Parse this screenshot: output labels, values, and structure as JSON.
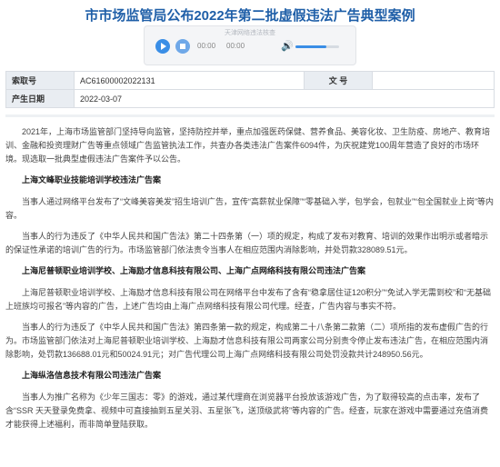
{
  "title": "市市场监管局公布2022年第二批虚假违法广告典型案例",
  "player": {
    "caption": "天津网络违法核查",
    "current_time": "00:00",
    "total_time": "00:00"
  },
  "meta": {
    "index_label": "索取号",
    "index_value": "AC61600002022131",
    "docno_label": "文 号",
    "docno_value": "",
    "date_label": "产生日期",
    "date_value": "2022-03-07"
  },
  "content": {
    "intro": "2021年，上海市场监管部门坚持导向监管，坚持防控并举，重点加强医药保健、营养食品、美容化妆、卫生防疫、房地产、教育培训、金融和投资理财广告等重点领域广告监管执法工作，共查办各类违法广告案件6094件，为庆祝建党100周年营造了良好的市场环境。现选取一批典型虚假违法广告案件予以公告。",
    "case1_title": "上海文峰职业技能培训学校违法广告案",
    "case1_p1": "当事人通过网络平台发布了“文峰美容美发”招生培训广告，宣传“高薪就业保障”“零基础入学，包学会，包就业”“包全国就业上岗”等内容。",
    "case1_p2": "当事人的行为违反了《中华人民共和国广告法》第二十四条第（一）项的规定，构成了发布对教育、培训的效果作出明示或者暗示的保证性承诺的培训广告的行为。市场监管部门依法责令当事人在相应范围内消除影响，并处罚款328089.51元。",
    "case2_title": "上海尼普顿职业培训学校、上海励才信息科技有限公司、上海广点网络科技有限公司违法广告案",
    "case2_p1": "上海尼普顿职业培训学校、上海励才信息科技有限公司在网络平台中发布了含有“稳拿居住证120积分”“免试入学无需到校”和“无基础 上班族均可报名”等内容的广告，上述广告均由上海广点网络科技有限公司代理。经查，广告内容与事实不符。",
    "case2_p2": "当事人的行为违反了《中华人民共和国广告法》第四条第一款的规定，构成第二十八条第二款第（二）项所指的发布虚假广告的行为。市场监管部门依法对上海尼普顿职业培训学校、上海励才信息科技有限公司两家公司分别责令停止发布违法广告，在相应范围内消除影响，处罚款136688.01元和50024.91元；对广告代理公司上海广点网络科技有限公司处罚没款共计248950.56元。",
    "case3_title": "上海纵洛信息技术有限公司违法广告案",
    "case3_p1": "当事人为推广名称为《少年三国志：零》的游戏，通过某代理商在浏览器平台投放该游戏广告，为了取得较高的点击率，发布了含“SSR 天天登录免费拿、视频中可直接抽到五星关羽、五星张飞，送顶级武将”等内容的广告。经查，玩家在游戏中需要通过充值消费才能获得上述福利，而非简单登陆获取。"
  }
}
